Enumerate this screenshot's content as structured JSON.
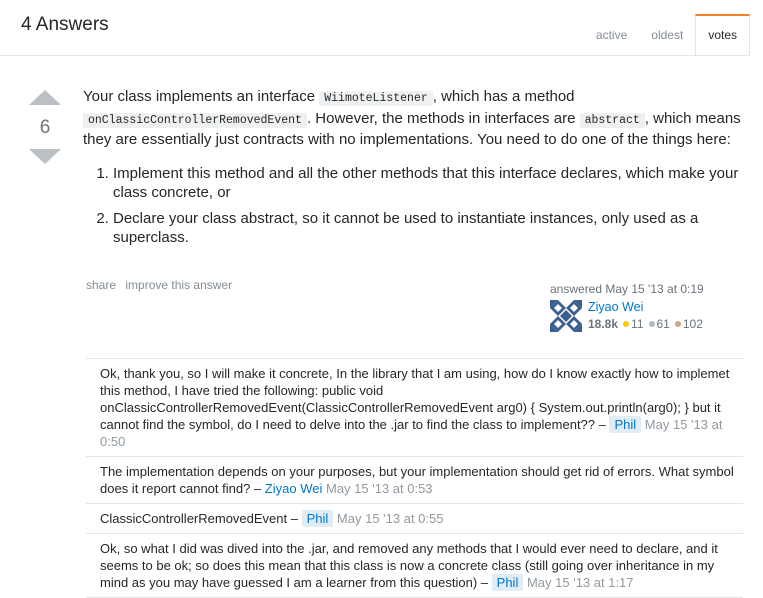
{
  "header": {
    "title": "4 Answers",
    "tabs": [
      "active",
      "oldest",
      "votes"
    ]
  },
  "vote": {
    "count": "6"
  },
  "answer": {
    "p_parts": [
      "Your class implements an interface ",
      "WiimoteListener",
      ", which has a method ",
      "onClassicControllerRemovedEvent",
      ". However, the methods in interfaces are ",
      "abstract",
      ", which means they are essentially just contracts with no implementations. You need to do one of the things here:"
    ],
    "list": [
      "Implement this method and all the other methods that this interface declares, which make your class concrete, or",
      "Declare your class abstract, so it cannot be used to instantiate instances, only used as a superclass."
    ]
  },
  "post_menu": {
    "share": "share",
    "improve": "improve this answer"
  },
  "signature": {
    "action_time": "answered May 15 '13 at 0:19",
    "username": "Ziyao Wei",
    "reputation": "18.8k",
    "gold": "11",
    "silver": "61",
    "bronze": "102",
    "colors": {
      "gold": "#ffcc01",
      "silver": "#b4b8bc",
      "bronze": "#d1a684"
    }
  },
  "comments": [
    {
      "text": "Ok, thank you, so I will make it concrete, In the library that I am using, how do I know exactly how to implemet this method, I have tried the following: public void onClassicControllerRemovedEvent(ClassicControllerRemovedEvent arg0) { System.out.println(arg0); } but it cannot find the symbol, do I need to delve into the .jar to find the class to implement?? –",
      "user": "Phil",
      "date": "May 15 '13 at 0:50"
    },
    {
      "text": "The implementation depends on your purposes, but your implementation should get rid of errors. What symbol does it report cannot find? –",
      "user": "Ziyao Wei",
      "date": "May 15 '13 at 0:53"
    },
    {
      "text": "ClassicControllerRemovedEvent –",
      "user": "Phil",
      "date": "May 15 '13 at 0:55"
    },
    {
      "text": "Ok, so what I did was dived into the .jar, and removed any methods that I would ever need to declare, and it seems to be ok; so does this mean that this class is now a concrete class (still going over inheritance in my mind as you may have guessed I am a learner from this question) –",
      "user": "Phil",
      "date": "May 15 '13 at 1:17"
    }
  ]
}
